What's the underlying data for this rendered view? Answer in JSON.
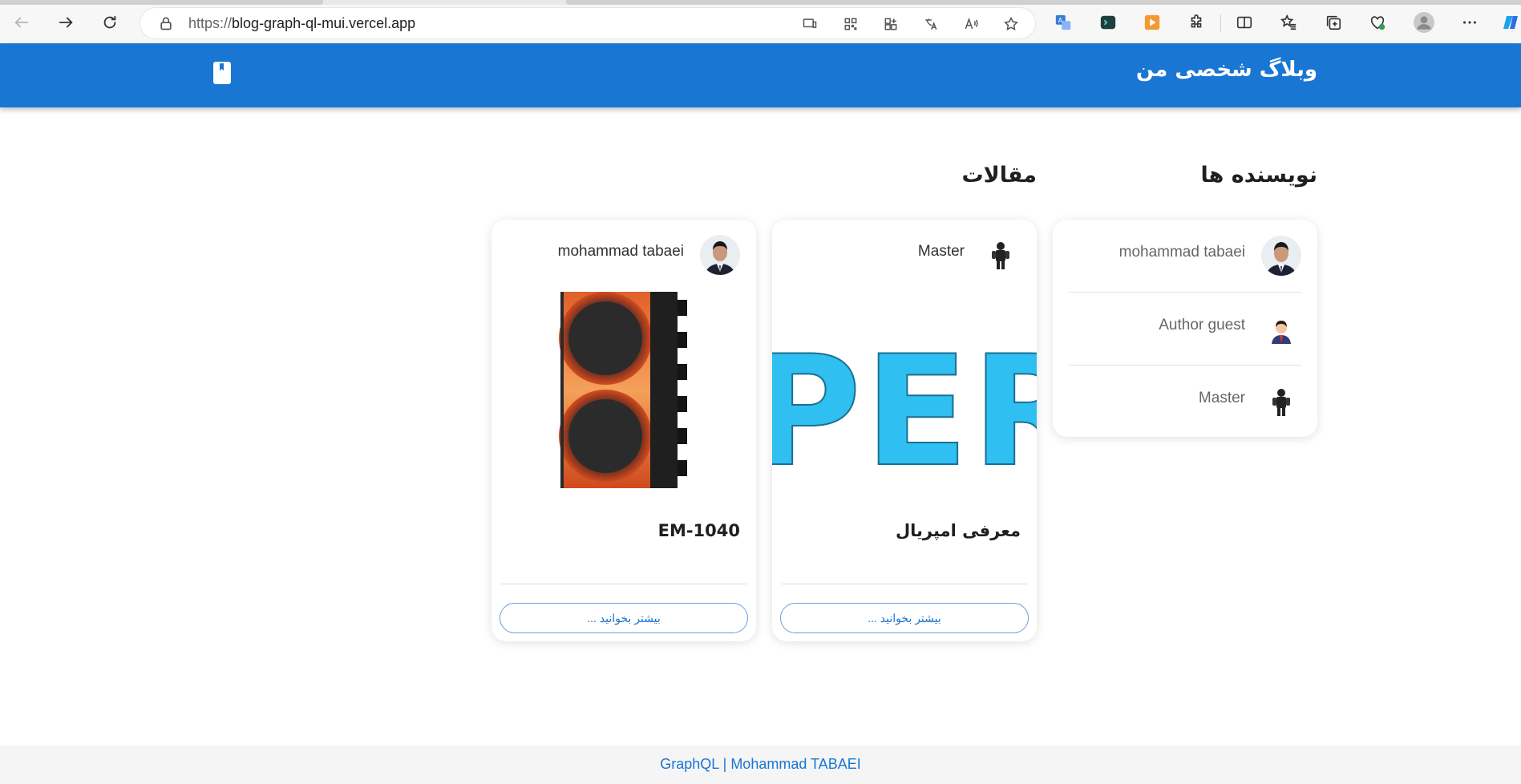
{
  "browser": {
    "url_scheme": "https://",
    "url_host": "blog-graph-ql-mui.vercel.app"
  },
  "header": {
    "site_title": "وبلاگ شخصی من",
    "background_color": "#1976d2"
  },
  "authors": {
    "title": "نویسنده ها",
    "items": [
      {
        "name": "mohammad tabaei",
        "avatar": "person-suit-icon"
      },
      {
        "name": "Author guest",
        "avatar": "person-cartoon-icon"
      },
      {
        "name": "Master",
        "avatar": "figure-black-icon"
      }
    ]
  },
  "articles": {
    "title": "مقالات",
    "posts": [
      {
        "author": "Master",
        "image_text": "PER",
        "title": "معرفی امپریال",
        "read_more": "بیشتر بخوانید ..."
      },
      {
        "author": "mohammad tabaei",
        "title": "EM-1040",
        "read_more": "بیشتر بخوانید ..."
      }
    ]
  },
  "footer": {
    "text": "GraphQL | Mohammad TABAEI"
  }
}
